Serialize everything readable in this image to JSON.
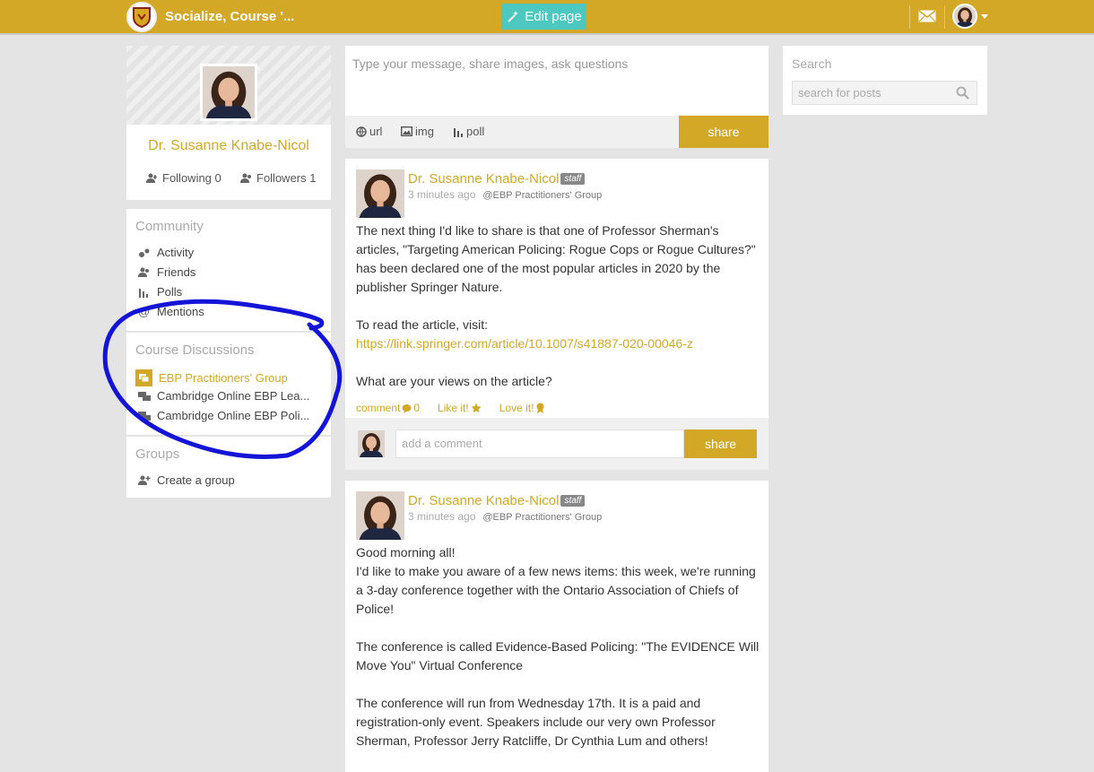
{
  "header": {
    "site_title": "Socialize, Course '...",
    "edit_label": "Edit page"
  },
  "profile": {
    "name": "Dr. Susanne Knabe-Nicol",
    "following": "Following 0",
    "followers": "Followers 1"
  },
  "community": {
    "title": "Community",
    "items": [
      "Activity",
      "Friends",
      "Polls",
      "Mentions"
    ]
  },
  "course_discussions": {
    "title": "Course Discussions",
    "items": [
      "EBP Practitioners' Group",
      "Cambridge Online EBP Lea...",
      "Cambridge Online EBP Poli..."
    ]
  },
  "groups": {
    "title": "Groups",
    "create": "Create a group"
  },
  "composer": {
    "placeholder": "Type your message, share images, ask questions",
    "url": "url",
    "img": "img",
    "poll": "poll",
    "share": "share"
  },
  "posts": [
    {
      "author": "Dr. Susanne Knabe-Nicol",
      "badge": "staff",
      "time": "3 minutes ago",
      "group": "@EBP Practitioners' Group",
      "p1": "The next thing I'd like to share is that one of Professor Sherman's articles, \"Targeting American Policing: Rogue Cops or Rogue Cultures?\" has been declared one of the most popular articles in 2020 by the publisher Springer Nature.",
      "p2": "To read the article, visit:",
      "link": "https://link.springer.com/article/10.1007/s41887-020-00046-z",
      "p3": "What are your views on the article?",
      "comment_label": "comment",
      "comment_count": "0",
      "like": "Like it!",
      "love": "Love it!",
      "comment_placeholder": "add a comment",
      "share": "share"
    },
    {
      "author": "Dr. Susanne Knabe-Nicol",
      "badge": "staff",
      "time": "3 minutes ago",
      "group": "@EBP Practitioners' Group",
      "p1a": "Good morning all!",
      "p1b": "I'd like to make you aware of a few news items: this week, we're running a 3-day conference together with the Ontario Association of Chiefs of Police!",
      "p2": "The conference is called Evidence-Based Policing: \"The EVIDENCE Will Move You\" Virtual Conference",
      "p3": "The conference will run from Wednesday 17th. It is a paid and registration-only event. Speakers include our very own Professor Sherman, Professor Jerry Ratcliffe, Dr Cynthia Lum and others!"
    }
  ],
  "search": {
    "title": "Search",
    "placeholder": "search for posts"
  },
  "colors": {
    "brand": "#d3a827",
    "edit_button": "#4dc8c0",
    "annotation": "#1414d8"
  }
}
